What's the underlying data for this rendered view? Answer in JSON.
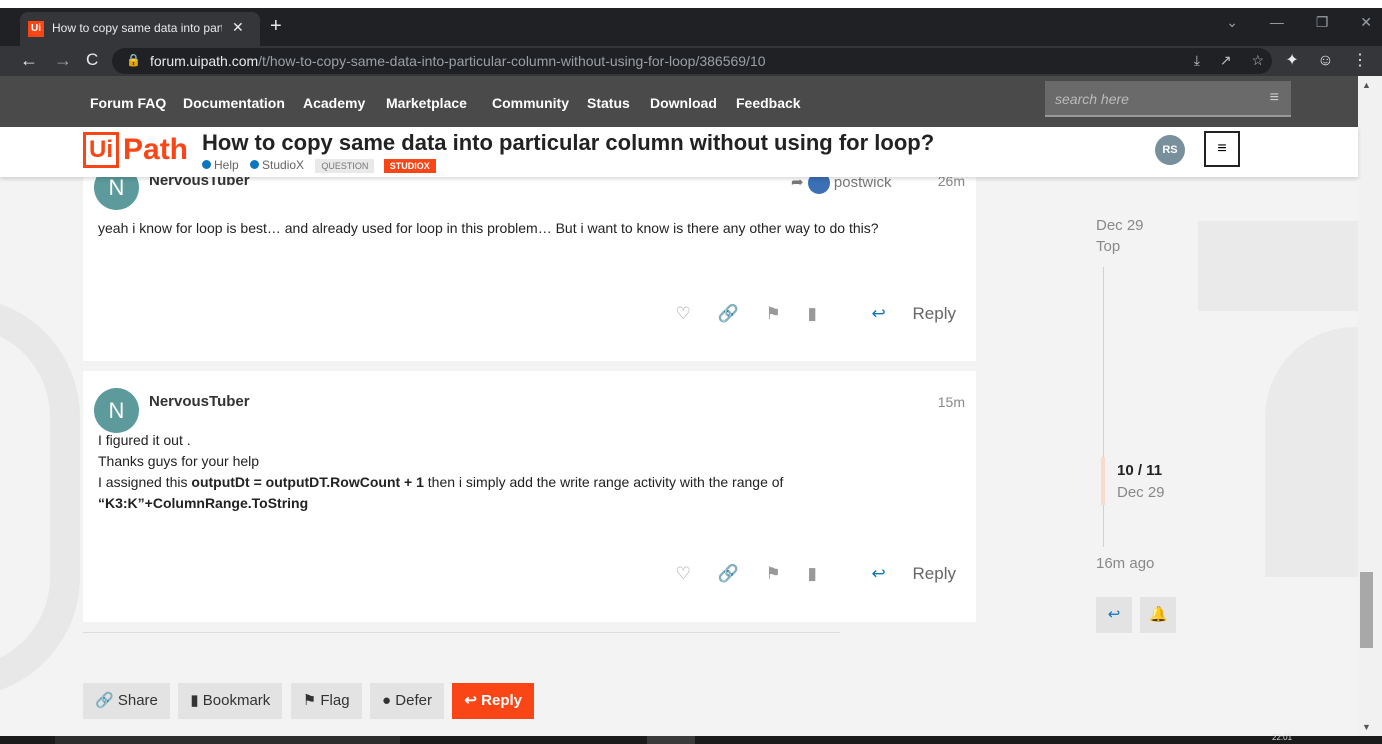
{
  "browser": {
    "tab_title": "How to copy same data into parti",
    "tab_favicon": "Ui",
    "close_glyph": "✕",
    "new_tab_glyph": "+",
    "url_host": "forum.uipath.com",
    "url_path": "/t/how-to-copy-same-data-into-particular-column-without-using-for-loop/386569/10"
  },
  "menu": {
    "items": [
      "Forum FAQ",
      "Documentation",
      "Academy",
      "Marketplace",
      "Community",
      "Status",
      "Download",
      "Feedback"
    ],
    "search_placeholder": "search here"
  },
  "header": {
    "logo_ui": "Ui",
    "logo_path": "Path",
    "topic_title": "How to copy same data into particular column without using for loop?",
    "categories": [
      "Help",
      "StudioX"
    ],
    "tags": [
      "QUESTION",
      "STUDIOX"
    ],
    "avatar_initials": "RS",
    "menu_glyph": "≡"
  },
  "posts": [
    {
      "avatar_letter": "N",
      "username": "NervousTuber",
      "reply_to": "postwick",
      "time": "26m",
      "body": "yeah i know for loop is best… and already used for loop in this problem… But i want to know is there any other way to do this?",
      "reply_label": "Reply"
    },
    {
      "avatar_letter": "N",
      "username": "NervousTuber",
      "time": "15m",
      "line1": "I figured it out .",
      "line2": "Thanks guys for your help",
      "line3_pre": "I assigned this ",
      "line3_bold": "outputDt = outputDT.RowCount + 1",
      "line3_post": " then i simply add the write range activity with the range of",
      "line4": "“K3:K”+ColumnRange.ToString",
      "reply_label": "Reply"
    }
  ],
  "bottom_buttons": {
    "share": "Share",
    "bookmark": "Bookmark",
    "flag": "Flag",
    "defer": "Defer",
    "reply": "Reply"
  },
  "timeline": {
    "start_date": "Dec 29",
    "top_label": "Top",
    "position": "10 / 11",
    "position_date": "Dec 29",
    "last_activity": "16m ago"
  },
  "taskbar": {
    "clock": "22:01"
  },
  "colors": {
    "brand": "#fa4616",
    "category": "#0e76bd",
    "avatar": "#5c9a9b"
  }
}
